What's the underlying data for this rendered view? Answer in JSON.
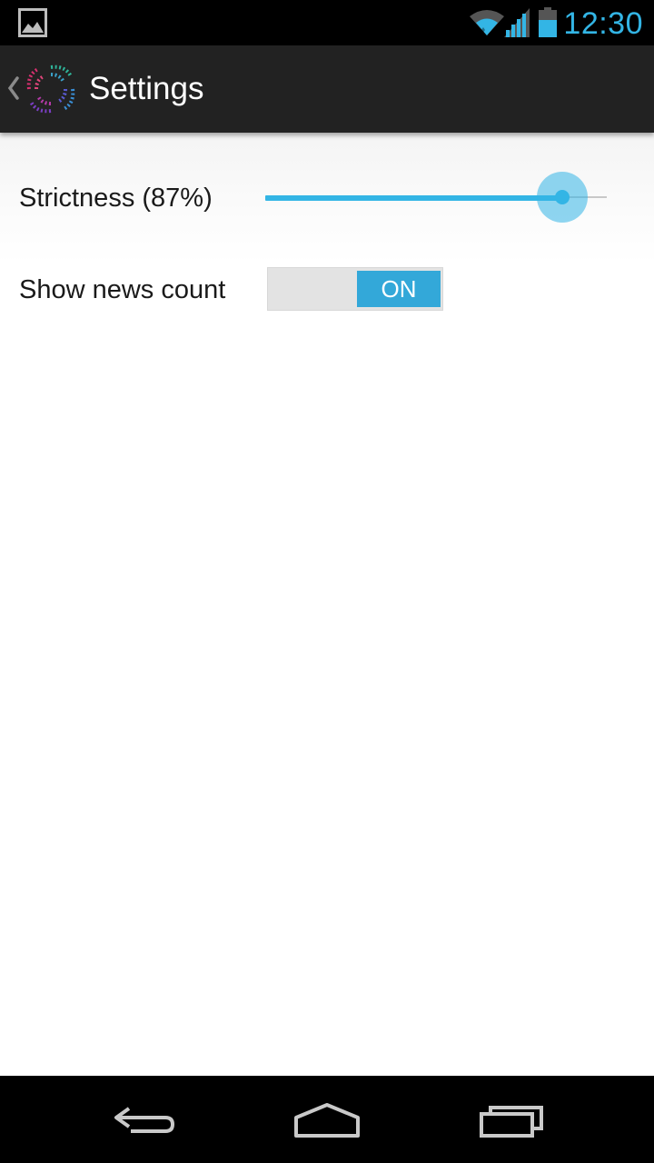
{
  "status_bar": {
    "time": "12:30",
    "icons": [
      "image-notification-icon",
      "wifi-icon",
      "signal-icon",
      "battery-icon"
    ]
  },
  "action_bar": {
    "title": "Settings",
    "icons": [
      "back-chevron-icon",
      "app-logo-icon"
    ]
  },
  "settings": {
    "strictness": {
      "label": "Strictness (87%)",
      "value_percent": 87
    },
    "show_news_count": {
      "label": "Show news count",
      "toggle_label": "ON",
      "checked": true
    }
  },
  "nav_bar": {
    "icons": [
      "back-icon",
      "home-icon",
      "recents-icon"
    ]
  },
  "colors": {
    "accent": "#33b5e5",
    "action_bar_bg": "#222222",
    "status_bar_bg": "#000000"
  }
}
